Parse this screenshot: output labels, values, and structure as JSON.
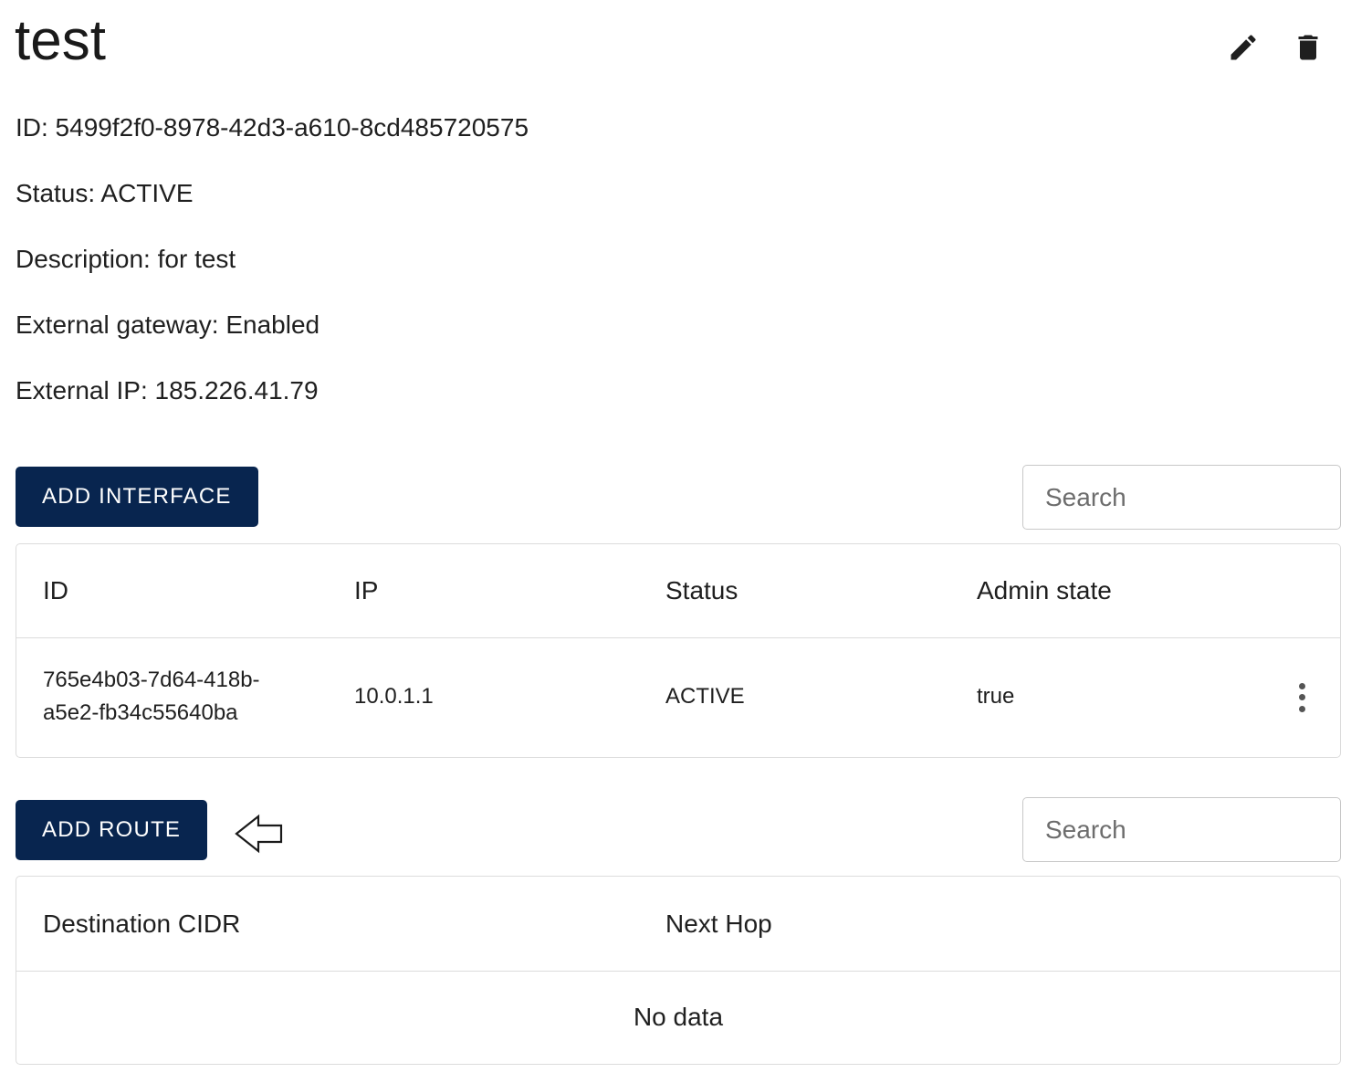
{
  "header": {
    "title": "test",
    "edit_icon": "pencil-icon",
    "delete_icon": "trash-icon"
  },
  "details": {
    "id": "ID: 5499f2f0-8978-42d3-a610-8cd485720575",
    "status": "Status: ACTIVE",
    "description": "Description: for test",
    "external_gateway": "External gateway: Enabled",
    "external_ip": "External IP: 185.226.41.79"
  },
  "interfaces": {
    "add_button_label": "ADD INTERFACE",
    "search_placeholder": "Search",
    "columns": [
      "ID",
      "IP",
      "Status",
      "Admin state"
    ],
    "rows": [
      {
        "id_line1": "765e4b03-7d64-418b-",
        "id_line2": "a5e2-fb34c55640ba",
        "ip": "10.0.1.1",
        "status": "ACTIVE",
        "admin_state": "true"
      }
    ]
  },
  "routes": {
    "add_button_label": "ADD ROUTE",
    "search_placeholder": "Search",
    "columns": [
      "Destination CIDR",
      "Next Hop"
    ],
    "empty_text": "No data"
  },
  "colors": {
    "primary": "#08254f",
    "border": "#dcdcdc"
  }
}
